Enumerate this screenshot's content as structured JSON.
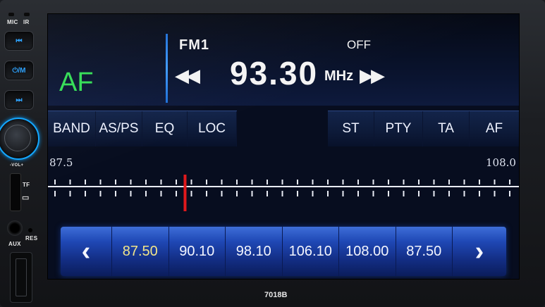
{
  "panel": {
    "mic_label": "MIC",
    "ir_label": "IR",
    "prev_button": "⏮",
    "power_mute_button": "⏻/M",
    "next_button": "⏭",
    "vol_label": "-VOL+",
    "tf_label": "TF",
    "aux_label": "AUX",
    "res_label": "RES",
    "model": "7018B"
  },
  "display": {
    "af_indicator": "AF",
    "band": "FM1",
    "status": "OFF",
    "frequency": "93.30",
    "unit": "MHz",
    "seek_back": "◀◀",
    "seek_forward": "▶▶"
  },
  "function_buttons_left": [
    "BAND",
    "AS/PS",
    "EQ",
    "LOC"
  ],
  "function_buttons_right": [
    "ST",
    "PTY",
    "TA",
    "AF"
  ],
  "scale": {
    "min_label": "87.5",
    "max_label": "108.0",
    "min": 87.5,
    "max": 108.0,
    "tuned": 93.3,
    "needle_color": "#e0191c"
  },
  "presets": {
    "prev_arrow": "‹",
    "next_arrow": "›",
    "stations": [
      "87.50",
      "90.10",
      "98.10",
      "106.10",
      "108.00",
      "87.50"
    ],
    "selected_index": 0
  },
  "colors": {
    "af_green": "#33dd55",
    "accent_blue": "#1e6fd6",
    "selected_preset": "#f2e58a"
  }
}
